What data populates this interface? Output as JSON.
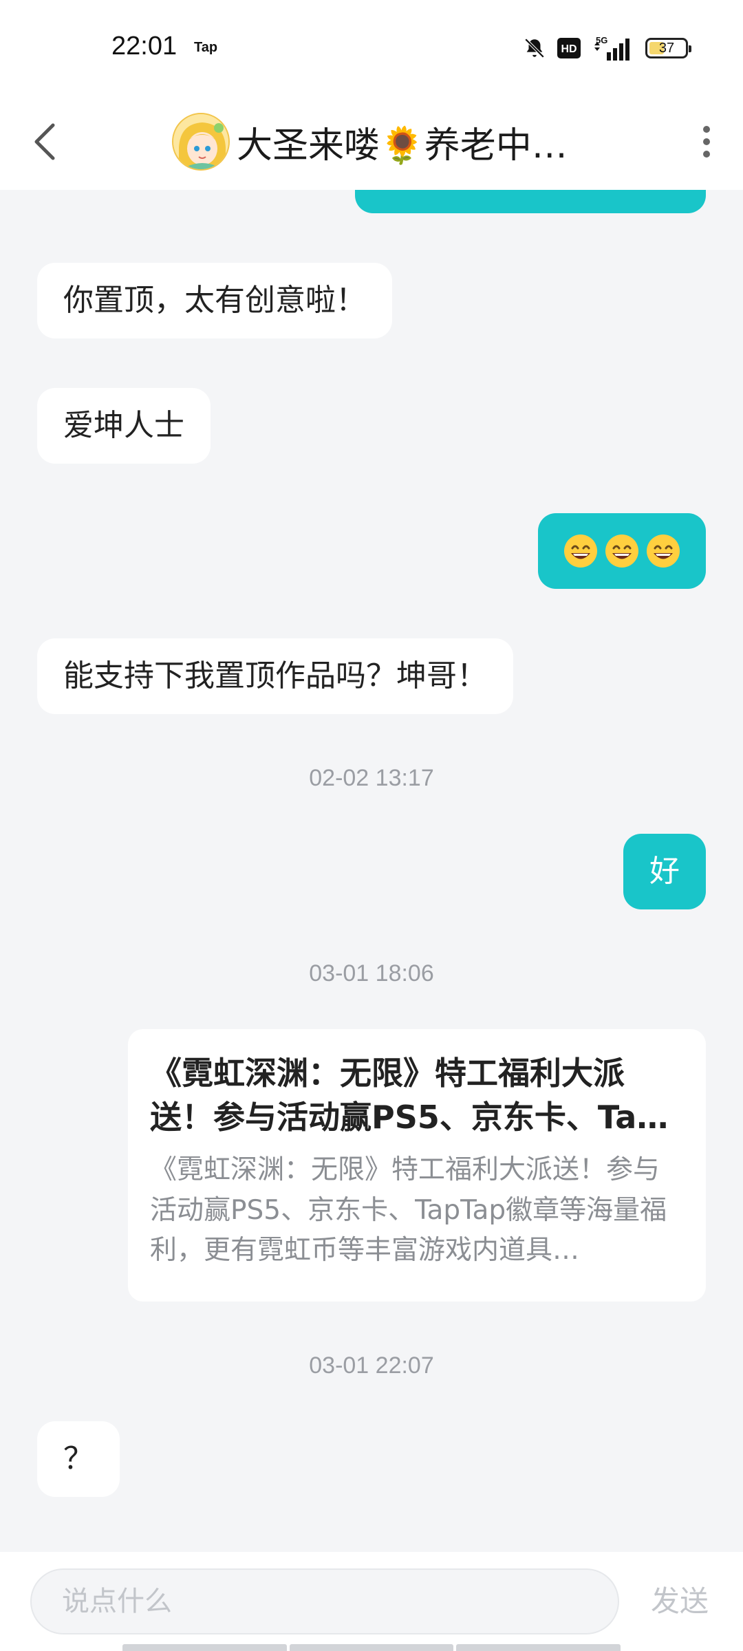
{
  "status_bar": {
    "time": "22:01",
    "carrier_badge": "Tap",
    "network": "5G",
    "battery_level": "37",
    "icons": [
      "bell-off-icon",
      "hd-icon",
      "signal-5g-icon",
      "battery-icon"
    ]
  },
  "header": {
    "back_icon": "chevron-left-icon",
    "title": "大圣来喽🌻养老中…",
    "more_icon": "more-vertical-icon"
  },
  "messages": [
    {
      "side": "in",
      "text": "你置顶，太有创意啦！"
    },
    {
      "side": "in",
      "text": "爱坤人士"
    },
    {
      "side": "out",
      "text": "😄😄😄"
    },
    {
      "side": "in",
      "text": "能支持下我置顶作品吗？坤哥！"
    },
    {
      "type": "timestamp",
      "text": "02-02 13:17"
    },
    {
      "side": "out",
      "text": "好"
    },
    {
      "type": "timestamp",
      "text": "03-01 18:06"
    },
    {
      "side": "out",
      "type": "link-card",
      "title": "《霓虹深渊：无限》特工福利大派送！参与活动赢PS5、京东卡、Ta…",
      "desc": "《霓虹深渊：无限》特工福利大派送！参与活动赢PS5、京东卡、TapTap徽章等海量福利，更有霓虹币等丰富游戏内道具…"
    },
    {
      "type": "timestamp",
      "text": "03-01 22:07"
    },
    {
      "side": "in",
      "text": "？"
    }
  ],
  "input": {
    "placeholder": "说点什么",
    "send_label": "发送"
  },
  "colors": {
    "accent": "#19c5c9",
    "background": "#f4f5f7",
    "incoming_bubble": "#ffffff",
    "timestamp": "#9a9da3"
  }
}
